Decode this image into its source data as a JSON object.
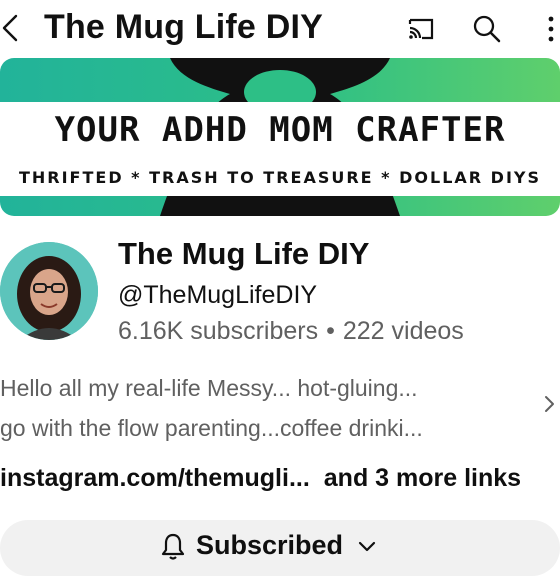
{
  "header": {
    "title": "The Mug Life DIY",
    "icons": [
      "back-icon",
      "cast-icon",
      "search-icon",
      "more-vertical-icon"
    ]
  },
  "banner": {
    "headline": "YOUR ADHD MOM CRAFTER",
    "tagline": "THRIFTED * TRASH TO TREASURE * DOLLAR DIYS",
    "colors": {
      "gradient_start": "#22b39a",
      "gradient_end": "#5fcf6c",
      "shape": "#111111"
    }
  },
  "channel": {
    "name": "The Mug Life DIY",
    "handle": "@TheMugLifeDIY",
    "subscribers": "6.16K subscribers",
    "separator": "•",
    "videos": "222 videos"
  },
  "description": {
    "line1": "Hello all my real-life Messy... hot-gluing...",
    "line2": "go with the flow parenting...coffee drinki..."
  },
  "links": {
    "primary": "instagram.com/themugli...",
    "more": "and 3 more links"
  },
  "subscribe": {
    "label": "Subscribed",
    "bg": "#f1f1f1"
  }
}
